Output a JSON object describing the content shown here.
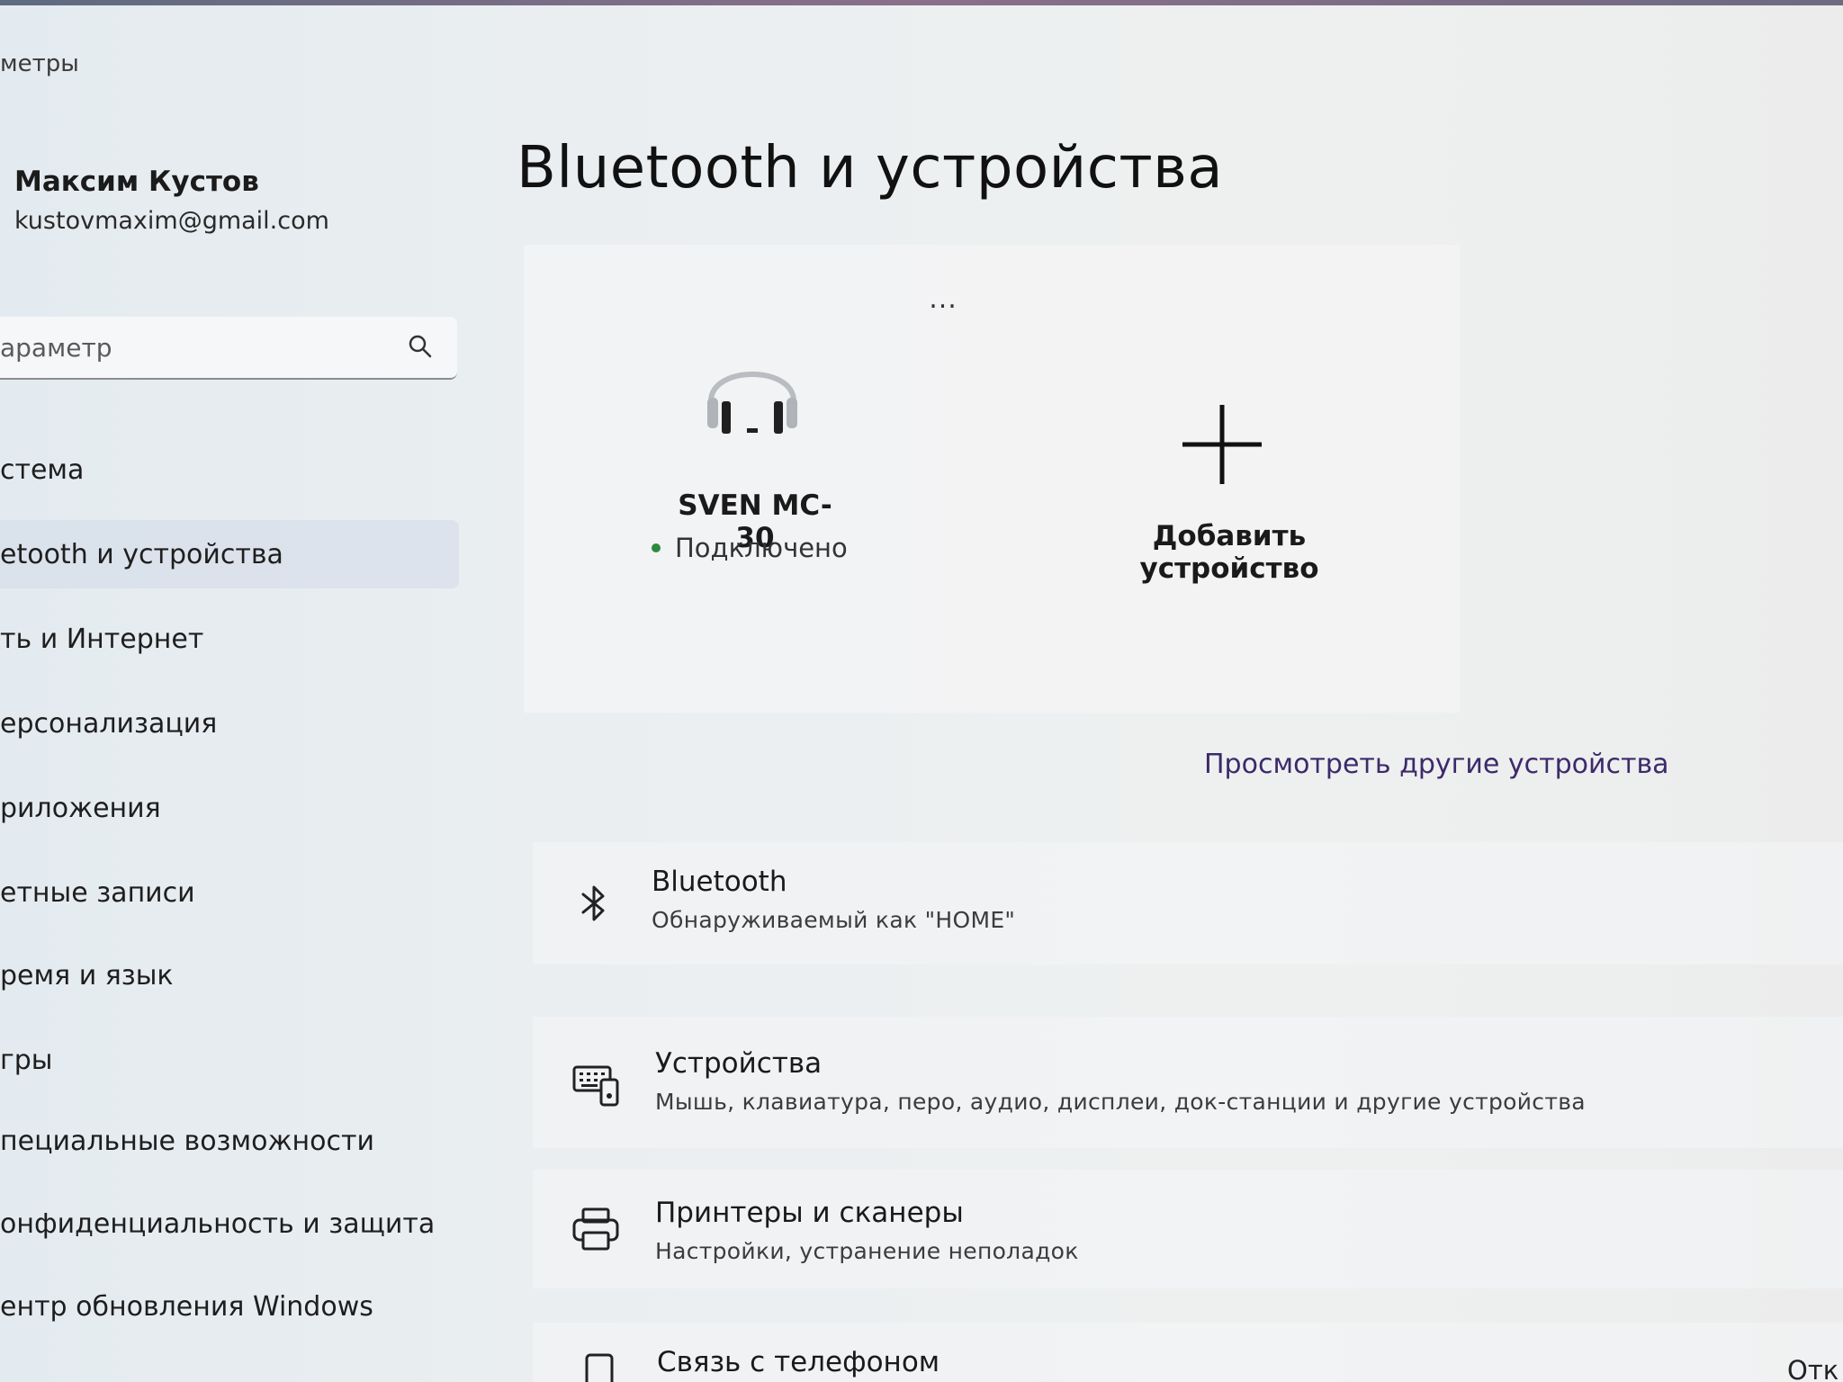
{
  "app": {
    "title": "метры"
  },
  "profile": {
    "name": "Максим Кустов",
    "email": "kustovmaxim@gmail.com"
  },
  "search": {
    "placeholder": "араметр",
    "icon": "search-icon"
  },
  "nav": {
    "items": [
      {
        "label": "стема"
      },
      {
        "label": "etooth и устройства",
        "active": true
      },
      {
        "label": "ть и Интернет"
      },
      {
        "label": "ерсонализация"
      },
      {
        "label": "риложения"
      },
      {
        "label": "етные записи"
      },
      {
        "label": "ремя и язык"
      },
      {
        "label": "гры"
      },
      {
        "label": "пециальные возможности"
      },
      {
        "label": "онфиденциальность и защита"
      },
      {
        "label": "ентр обновления Windows"
      }
    ]
  },
  "main": {
    "title": "Bluetooth и устройства",
    "device": {
      "name": "SVEN MC-30",
      "status": "Подключено",
      "status_color": "#2b8a3e",
      "icon": "headphones-icon"
    },
    "more_label": "...",
    "add_device": {
      "label": "Добавить устройство",
      "icon": "plus-icon"
    },
    "view_more_link": "Просмотреть другие устройства",
    "rows": [
      {
        "title": "Bluetooth",
        "subtitle": "Обнаруживаемый как \"HOME\"",
        "icon": "bluetooth-icon"
      },
      {
        "title": "Устройства",
        "subtitle": "Мышь, клавиатура, перо, аудио, дисплеи, док-станции и другие устройства",
        "icon": "devices-icon"
      },
      {
        "title": "Принтеры и сканеры",
        "subtitle": "Настройки, устранение неполадок",
        "icon": "printer-icon"
      },
      {
        "title": "Связь с телефоном",
        "icon": "phone-icon"
      }
    ],
    "edge_text": "Отк"
  },
  "colors": {
    "link": "#3c2a6b",
    "active_nav": "#d2dae8"
  }
}
